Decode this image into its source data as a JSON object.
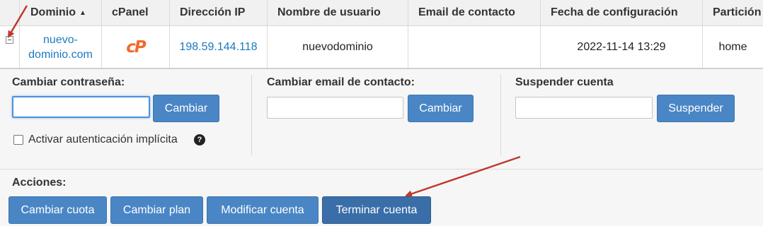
{
  "table": {
    "headers": {
      "domain": "Dominio",
      "cpanel": "cPanel",
      "ip": "Dirección IP",
      "user": "Nombre de usuario",
      "email": "Email de contacto",
      "date": "Fecha de configuración",
      "partition": "Partición"
    },
    "row": {
      "domain_line1": "nuevo-",
      "domain_line2": "dominio.com",
      "cpanel_logo": "cP",
      "ip": "198.59.144.118",
      "user": "nuevodominio",
      "email": "",
      "date": "2022-11-14 13:29",
      "partition": "home"
    }
  },
  "panel": {
    "password": {
      "title": "Cambiar contraseña:",
      "value": "",
      "button": "Cambiar",
      "checkbox_label": "Activar autenticación implícita",
      "help_icon": "question-circle-icon"
    },
    "contact_email": {
      "title": "Cambiar email de contacto:",
      "value": "",
      "button": "Cambiar"
    },
    "suspend": {
      "title": "Suspender cuenta",
      "value": "",
      "button": "Suspender"
    },
    "actions": {
      "title": "Acciones:",
      "buttons": [
        "Cambiar cuota",
        "Cambiar plan",
        "Modificar cuenta",
        "Terminar cuenta"
      ]
    }
  },
  "colors": {
    "link": "#1a7bbf",
    "button": "#4a86c5",
    "cpanel_orange": "#f26a2b",
    "annotation_arrow": "#c0392b"
  }
}
